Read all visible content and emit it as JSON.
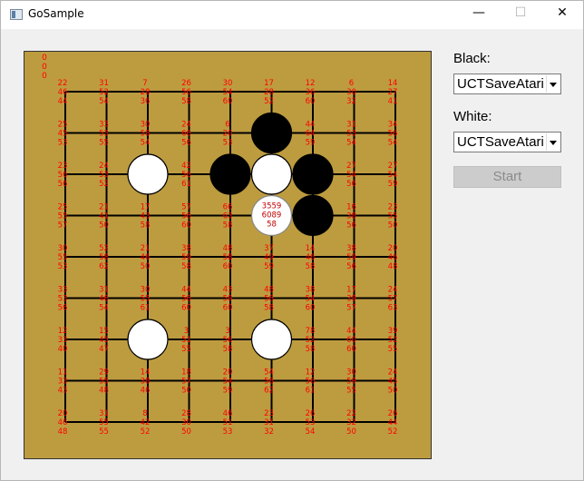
{
  "window": {
    "title": "GoSample",
    "minimize_glyph": "—",
    "maximize_glyph": "☐",
    "close_glyph": "✕"
  },
  "board": {
    "size": 9,
    "corner_text": [
      "0",
      "0",
      "0"
    ],
    "point_stats": [
      [
        "22,46,44",
        "31,52,54",
        "7,28,36",
        "26,56,58",
        "30,54,60",
        "17,28,52",
        "12,36,60",
        "6,30,32",
        "14,27,41"
      ],
      [
        "25,45,53",
        "33,53,55",
        "30,58,54",
        "24,66,56",
        "6,20,53",
        "",
        "44,64,59",
        "31,53,54",
        "34,56,54"
      ],
      [
        "23,56,56",
        "24,53,52",
        "",
        "42,56,61",
        "",
        "",
        "",
        "27,54,56",
        "27,54,59"
      ],
      [
        "25,55,57",
        "21,41,50",
        "17,43,58",
        "57,56,60",
        "66,63,58",
        "",
        "",
        "16,38,56",
        "23,55,50"
      ],
      [
        "30,55,53",
        "52,58,62",
        "21,46,50",
        "38,59,58",
        "48,58,60",
        "37,49,59",
        "14,46,58",
        "38,59,56",
        "20,46,48"
      ],
      [
        "33,53,56",
        "31,46,54",
        "30,55,61",
        "44,56,60",
        "43,59,60",
        "48,56,58",
        "38,54,60",
        "17,39,57",
        "24,57,63"
      ],
      [
        "12,33,40",
        "15,45,47",
        "",
        "3,51,55",
        "3,56,58",
        "",
        "78,52,58",
        "44,60,60",
        "39,52,55"
      ],
      [
        "11,33,43",
        "29,55,48",
        "14,38,46",
        "18,57,50",
        "20,54,59",
        "54,56,62",
        "12,56,61",
        "30,59,55",
        "24,45,50"
      ],
      [
        "20,46,48",
        "31,55,55",
        "8,42,52",
        "28,30,50",
        "46,51,53",
        "23,31,32",
        "26,53,54",
        "22,32,50",
        "26,44,52"
      ]
    ],
    "stones": [
      {
        "row": 1,
        "col": 5,
        "color": "black"
      },
      {
        "row": 2,
        "col": 2,
        "color": "white"
      },
      {
        "row": 2,
        "col": 4,
        "color": "black"
      },
      {
        "row": 2,
        "col": 5,
        "color": "white"
      },
      {
        "row": 2,
        "col": 6,
        "color": "black"
      },
      {
        "row": 3,
        "col": 6,
        "color": "black"
      },
      {
        "row": 6,
        "col": 2,
        "color": "white"
      },
      {
        "row": 6,
        "col": 5,
        "color": "white"
      }
    ],
    "highlight": {
      "row": 3,
      "col": 5,
      "lines": [
        "3559",
        "6089",
        "58"
      ]
    },
    "colors": {
      "board": "#bd9c40",
      "grid": "#000000",
      "stat_text": "#ff0000",
      "black_stone": "#000000",
      "white_stone": "#ffffff"
    }
  },
  "controls": {
    "black_label": "Black:",
    "black_player": "UCTSaveAtari",
    "white_label": "White:",
    "white_player": "UCTSaveAtari",
    "start_label": "Start"
  }
}
